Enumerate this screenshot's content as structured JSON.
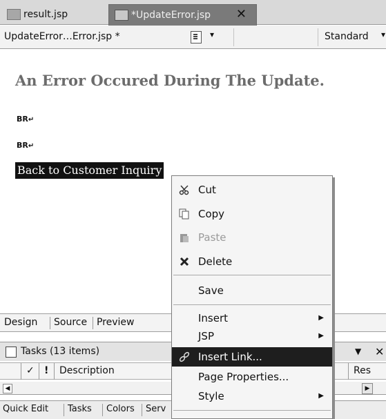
{
  "editor_tabs": [
    {
      "label": "result.jsp",
      "active": false
    },
    {
      "label": "*UpdateError.jsp",
      "active": true
    }
  ],
  "toolbar": {
    "breadcrumb": "UpdateError…Error.jsp *",
    "mode": "Standard"
  },
  "page": {
    "heading": "An Error Occured During The Update.",
    "br_markers": [
      "BR",
      "BR"
    ],
    "link_text": "Back to Customer Inquiry"
  },
  "view_tabs": [
    "Design",
    "Source",
    "Preview"
  ],
  "tasks_view": {
    "title": "Tasks (13 items)",
    "columns": [
      "✓",
      "!",
      "Description",
      "Res"
    ]
  },
  "bottom_tabs": [
    "Quick Edit",
    "Tasks",
    "Colors",
    "Serv"
  ],
  "context_menu": {
    "items": [
      {
        "label": "Cut",
        "icon": "scissors-icon",
        "enabled": true
      },
      {
        "label": "Copy",
        "icon": "copy-icon",
        "enabled": true
      },
      {
        "label": "Paste",
        "icon": "paste-icon",
        "enabled": false
      },
      {
        "label": "Delete",
        "icon": "delete-icon",
        "enabled": true
      },
      {
        "label": "Save",
        "enabled": true
      },
      {
        "label": "Insert",
        "submenu": true,
        "enabled": true
      },
      {
        "label": "JSP",
        "submenu": true,
        "enabled": true
      },
      {
        "label": "Insert Link...",
        "icon": "link-icon",
        "enabled": true,
        "highlighted": true
      },
      {
        "label": "Page Properties...",
        "enabled": true
      },
      {
        "label": "Style",
        "submenu": true,
        "enabled": true
      }
    ]
  },
  "colors": {
    "selection": "#1e1e1e",
    "active_tab": "#7a7a7a",
    "heading": "#6c6c6c"
  }
}
